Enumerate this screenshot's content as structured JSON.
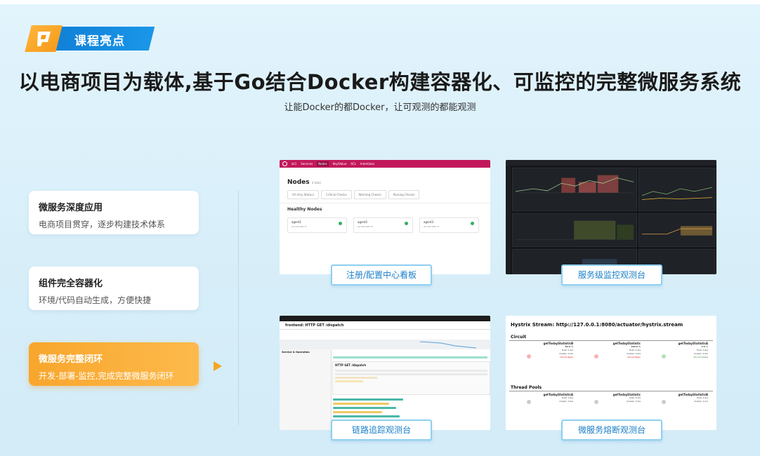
{
  "badge": {
    "label": "课程亮点",
    "icon": "play-logo-icon"
  },
  "headline": "以电商项目为载体,基于Go结合Docker构建容器化、可监控的完整微服务系统",
  "subline": "让能Docker的都Docker，让可观测的都能观测",
  "features": [
    {
      "title": "微服务深度应用",
      "desc": "电商项目贯穿，逐步构建技术体系",
      "active": false
    },
    {
      "title": "组件完全容器化",
      "desc": "环境/代码自动生成，方便快捷",
      "active": false
    },
    {
      "title": "微服务完整闭环",
      "desc": "开发-部署-监控,完成完整微服务闭环",
      "active": true
    }
  ],
  "captions": {
    "registry": "注册/配置中心看板",
    "monitor": "服务级监控观测台",
    "tracing": "链路追踪观测台",
    "breaker": "微服务熔断观测台"
  },
  "consul": {
    "nav": [
      "dc1",
      "Services",
      "Nodes",
      "Key/Value",
      "ACL",
      "Intentions"
    ],
    "title": "Nodes",
    "count": "3 total",
    "filters": [
      "All (Any Status)",
      "Critical Checks",
      "Warning Checks",
      "Passing Checks"
    ],
    "section": "Healthy Nodes",
    "nodes": [
      {
        "name": "agent1",
        "ip": "22.195.108.71"
      },
      {
        "name": "agent2",
        "ip": "22.195.108.72"
      },
      {
        "name": "agent3",
        "ip": "22.195.108.73"
      }
    ]
  },
  "jaeger": {
    "title": "frontend: HTTP GET /dispatch",
    "span": "HTTP GET /dispatch",
    "column": "Service & Operation"
  },
  "hystrix": {
    "title": "Hystrix Stream: http://127.0.0.1:8080/actuator/hystrix.stream",
    "circuit": "Circuit",
    "pools": "Thread Pools",
    "circuits": [
      {
        "name": "getTodayStatisticB",
        "pct": "80.0 %",
        "host": "Host: 0.3/s",
        "cluster": "Cluster: 0.3/s",
        "state": "Circuit Open"
      },
      {
        "name": "getTodayStatistic",
        "pct": "100.0 %",
        "host": "Host: 0.4/s",
        "cluster": "Cluster: 0.4/s",
        "state": "Circuit Open"
      },
      {
        "name": "getTodayStatisticA",
        "pct": "0.0 %",
        "host": "Host: 0.4/s",
        "cluster": "Cluster: 0.4/s",
        "state": "Circuit Closed"
      }
    ],
    "pool_names": [
      "getTodayStatisticA",
      "getTodayStatistic",
      "getTodayStatisticB"
    ],
    "pool_rates": [
      {
        "host": "Host: 0.4/s",
        "cluster": "Cluster: 0.4/s"
      },
      {
        "host": "Host: 0.3/s",
        "cluster": "Cluster: 0.3/s"
      },
      {
        "host": "Host: 0.1/s",
        "cluster": "Cluster: 0.1/s"
      }
    ]
  },
  "colors": {
    "accent_blue": "#1a8fe0",
    "accent_orange": "#f8a62c",
    "consul_pink": "#c2185b"
  }
}
